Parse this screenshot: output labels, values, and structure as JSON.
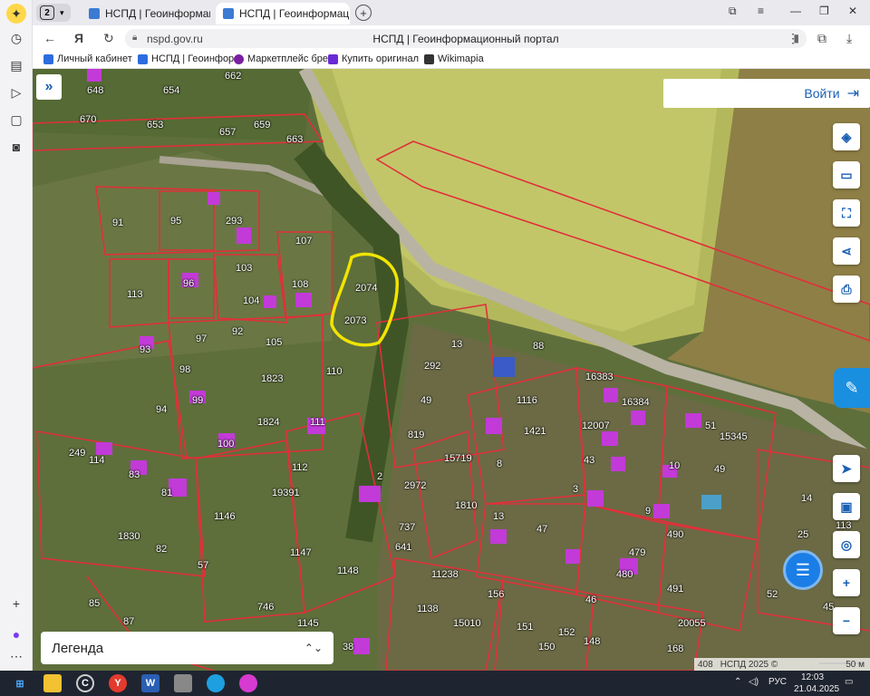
{
  "tabs": {
    "count": "2",
    "items": [
      {
        "title": "НСПД | Геоинформацион",
        "active": false
      },
      {
        "title": "НСПД | Геоинформацио",
        "active": true
      }
    ]
  },
  "address": {
    "host": "nspd.gov.ru",
    "title": "НСПД | Геоинформационный портал"
  },
  "bookmarks": [
    {
      "label": "Личный кабинет",
      "color": "#2d6cdf"
    },
    {
      "label": "НСПД | Геоинфор",
      "color": "#2d6cdf"
    },
    {
      "label": "Маркетплейс бре",
      "color": "#7a1fa2"
    },
    {
      "label": "Купить оригинал",
      "color": "#6a2bd6"
    },
    {
      "label": "Wikimapia",
      "color": "#333333"
    }
  ],
  "map": {
    "login_label": "Войти",
    "legend_label": "Легенда",
    "attribution": "НСПД 2025 ©",
    "attribution_num": "408",
    "scale": "50 м",
    "plots": [
      "648",
      "654",
      "662",
      "670",
      "653",
      "657",
      "659",
      "663",
      "91",
      "95",
      "293",
      "107",
      "103",
      "113",
      "96",
      "104",
      "108",
      "2074",
      "2073",
      "93",
      "97",
      "92",
      "105",
      "98",
      "1823",
      "110",
      "13",
      "292",
      "88",
      "16383",
      "99",
      "94",
      "49",
      "1116",
      "16384",
      "111",
      "1824",
      "12007",
      "1421",
      "819",
      "51",
      "15345",
      "249",
      "114",
      "100",
      "15719",
      "112",
      "83",
      "81",
      "19391",
      "2",
      "43",
      "10",
      "49",
      "2972",
      "8",
      "3",
      "9",
      "1810",
      "1146",
      "1830",
      "82",
      "737",
      "13",
      "47",
      "641",
      "1147",
      "57",
      "1148",
      "11238",
      "156",
      "479",
      "480",
      "491",
      "490",
      "746",
      "46",
      "85",
      "87",
      "1138",
      "15010",
      "151",
      "1145",
      "152",
      "150",
      "148",
      "20055",
      "168",
      "25",
      "14",
      "113",
      "52",
      "45",
      "38"
    ]
  },
  "taskbar": {
    "lang": "РУС",
    "time": "12:03",
    "date": "21.04.2025"
  },
  "colors": {
    "accent": "#1a5fb4",
    "highlight": "#f2e400",
    "boundary": "#e0303a"
  }
}
